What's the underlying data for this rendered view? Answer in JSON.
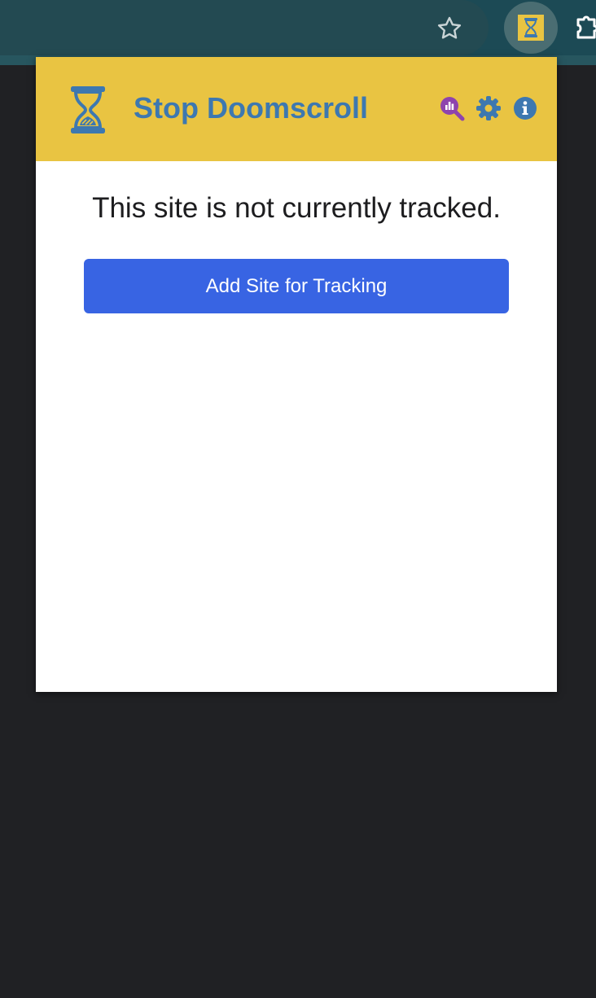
{
  "browser": {
    "icons": {
      "bookmark": "star-outline-icon",
      "extension": "hourglass-icon",
      "extensions_menu": "puzzle-icon"
    }
  },
  "popup": {
    "header": {
      "title": "Stop Doomscroll",
      "logo_icon": "hourglass-icon",
      "icons": [
        "analytics-search-icon",
        "gear-icon",
        "info-icon"
      ]
    },
    "message": "This site is not currently tracked.",
    "add_button_label": "Add Site for Tracking"
  },
  "colors": {
    "header_bg": "#e9c442",
    "title": "#3d78b0",
    "analytics_icon": "#8e44ad",
    "button_bg": "#3864e3",
    "page_bg": "#202124"
  }
}
